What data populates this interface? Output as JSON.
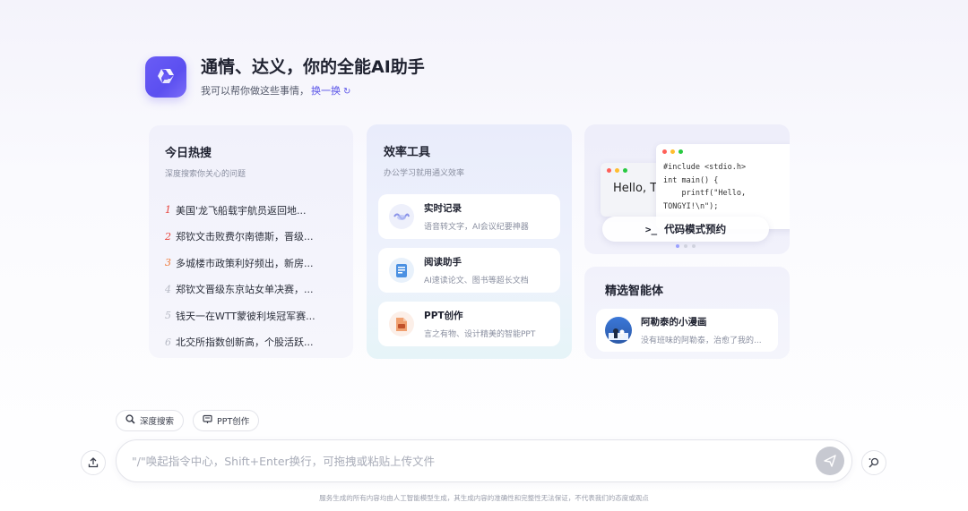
{
  "header": {
    "title": "通情、达义，你的全能AI助手",
    "subtitle": "我可以帮你做这些事情，",
    "refresh_label": "换一换",
    "refresh_icon": "↻"
  },
  "hot_search": {
    "title": "今日热搜",
    "subtitle": "深度搜索你关心的问题",
    "items": [
      {
        "rank": "1",
        "text": "美国'龙飞船载宇航员返回地..."
      },
      {
        "rank": "2",
        "text": "郑钦文击败费尔南德斯，晋级..."
      },
      {
        "rank": "3",
        "text": "多城楼市政策利好频出，新房..."
      },
      {
        "rank": "4",
        "text": "郑钦文晋级东京站女单决赛，..."
      },
      {
        "rank": "5",
        "text": "钱天一在WTT蒙彼利埃冠军赛..."
      },
      {
        "rank": "6",
        "text": "北交所指数创新高，个股活跃..."
      }
    ]
  },
  "efficiency": {
    "title": "效率工具",
    "subtitle": "办公学习就用通义效率",
    "tools": [
      {
        "name": "实时记录",
        "desc": "语音转文字，AI会议纪要神器",
        "icon": "audio-record-icon"
      },
      {
        "name": "阅读助手",
        "desc": "AI速读论文、图书等超长文档",
        "icon": "document-icon"
      },
      {
        "name": "PPT创作",
        "desc": "言之有物、设计精美的智能PPT",
        "icon": "ppt-icon"
      }
    ]
  },
  "code_card": {
    "hello": "Hello, T",
    "code": "#include <stdio.h>\nint main() {\n    printf(\"Hello,\nTONGYI!\\n\");",
    "button_prompt": ">_",
    "button_label": "代码模式预约"
  },
  "agents": {
    "title": "精选智能体",
    "items": [
      {
        "name": "阿勒泰的小漫画",
        "desc": "没有班味的阿勒泰，治愈了我的..."
      }
    ]
  },
  "chips": [
    {
      "label": "深度搜索",
      "icon": "search-icon"
    },
    {
      "label": "PPT创作",
      "icon": "ppt-icon"
    }
  ],
  "input": {
    "placeholder": "\"/\"唤起指令中心，Shift+Enter换行，可拖拽或粘贴上传文件"
  },
  "disclaimer": "服务生成的所有内容均由人工智能模型生成，其生成内容的准确性和完整性无法保证，不代表我们的态度或观点",
  "colors": {
    "accent": "#5a54e8",
    "rank_top": "#e8423a",
    "rank_third": "#ef7a3a",
    "rank_rest": "#b7bac5"
  }
}
